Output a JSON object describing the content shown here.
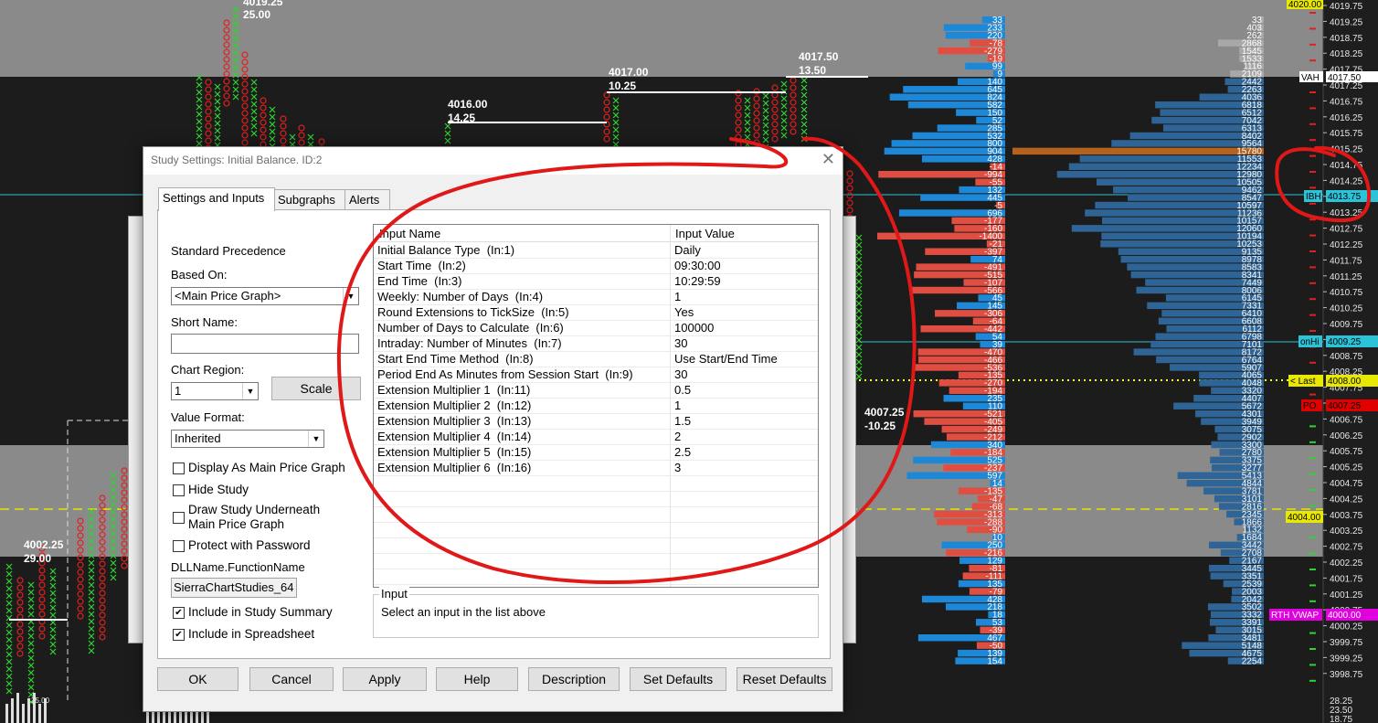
{
  "chart": {
    "price_ticks": [
      "4019.75",
      "4019.25",
      "4018.75",
      "4018.25",
      "4017.75",
      "4017.25",
      "4016.75",
      "4016.25",
      "4015.75",
      "4015.25",
      "4014.75",
      "4014.25",
      "4013.75",
      "4013.25",
      "4012.75",
      "4012.25",
      "4011.75",
      "4011.25",
      "4010.75",
      "4010.25",
      "4009.75",
      "4009.25",
      "4008.75",
      "4008.25",
      "4007.75",
      "4007.25",
      "4006.75",
      "4006.25",
      "4005.75",
      "4005.25",
      "4004.75",
      "4004.25",
      "4003.75",
      "4003.25",
      "4002.75",
      "4002.25",
      "4001.75",
      "4001.25",
      "4000.75",
      "4000.25",
      "3999.75",
      "3999.25",
      "3998.75"
    ],
    "bottom_ticks": [
      "28.25",
      "23.50",
      "18.75"
    ],
    "left_bottom_tick": "25.00",
    "annotations": [
      {
        "price": "4019.25",
        "value": "25.00"
      },
      {
        "price": "4016.00",
        "value": "14.25"
      },
      {
        "price": "4017.00",
        "value": "10.25"
      },
      {
        "price": "4017.50",
        "value": "13.50"
      },
      {
        "price": "4007.25",
        "value": "-10.25"
      },
      {
        "price": "4002.25",
        "value": "29.00"
      }
    ],
    "delta_values": [
      "33",
      "233",
      "220",
      "-78",
      "-279",
      "-19",
      "99",
      "9",
      "140",
      "645",
      "824",
      "582",
      "150",
      "52",
      "285",
      "532",
      "800",
      "904",
      "428",
      "-14",
      "-994",
      "-55",
      "132",
      "445",
      "-5",
      "696",
      "-177",
      "-160",
      "-1400",
      "-21",
      "-397",
      "74",
      "-491",
      "-515",
      "-107",
      "-566",
      "45",
      "145",
      "-306",
      "-64",
      "-442",
      "54",
      "39",
      "-470",
      "-466",
      "-536",
      "-135",
      "-270",
      "-194",
      "235",
      "110",
      "-521",
      "-405",
      "-249",
      "-212",
      "340",
      "-184",
      "525",
      "-237",
      "597",
      "14",
      "-135",
      "-47",
      "-68",
      "-313",
      "-288",
      "-90",
      "10",
      "250",
      "-216",
      "129",
      "-81",
      "-111",
      "135",
      "-79",
      "428",
      "218",
      "18",
      "53",
      "-39",
      "467",
      "-50",
      "139",
      "154"
    ],
    "volume_values": [
      "33",
      "403",
      "262",
      "2868",
      "1545",
      "1533",
      "1116",
      "2109",
      "2442",
      "2263",
      "4036",
      "6818",
      "6512",
      "7042",
      "6313",
      "8402",
      "9564",
      "15780",
      "11553",
      "12234",
      "12980",
      "10505",
      "9462",
      "8547",
      "10597",
      "11236",
      "10157",
      "12060",
      "10194",
      "10253",
      "9135",
      "8978",
      "8583",
      "8341",
      "7449",
      "8006",
      "6145",
      "7331",
      "6410",
      "6608",
      "6112",
      "6798",
      "7101",
      "8172",
      "6764",
      "5907",
      "4065",
      "4048",
      "3320",
      "4407",
      "5672",
      "4301",
      "3949",
      "3075",
      "2902",
      "3300",
      "2780",
      "3375",
      "3277",
      "5413",
      "4844",
      "3781",
      "3101",
      "2816",
      "2345",
      "1866",
      "1132",
      "1684",
      "3442",
      "2708",
      "2167",
      "3445",
      "3351",
      "2539",
      "2003",
      "2042",
      "3502",
      "3332",
      "3391",
      "3015",
      "3481",
      "5148",
      "4675",
      "2254"
    ],
    "tags": {
      "vah": "VAH",
      "ibh": "IBH",
      "ibh_price": "4013.75",
      "onh": "onHi",
      "onh_price": "4009.25",
      "last": "< Last",
      "last_price": "4008.00",
      "poc": "PO",
      "poc_price": "4007.25",
      "price_4004": "4004.00",
      "vwap": "RTH VWAP",
      "vwap_price": "4000.00",
      "top_price": "4020.00",
      "vah_price": "4017.50"
    },
    "colors": {
      "positive": "#1e88d8",
      "negative": "#e04e42",
      "volume": "#2e6596",
      "poc": "#b4621e",
      "annotation_circle": "#e01818"
    }
  },
  "dialog": {
    "title": "Study Settings: Initial Balance. ID:2",
    "close": "✕",
    "tabs": [
      "Settings and Inputs",
      "Subgraphs",
      "Alerts"
    ],
    "left": {
      "standard_precedence": "Standard Precedence",
      "based_on_label": "Based On:",
      "based_on_value": "<Main Price Graph>",
      "short_name_label": "Short Name:",
      "short_name_value": "",
      "chart_region_label": "Chart Region:",
      "chart_region_value": "1",
      "scale_button": "Scale",
      "value_format_label": "Value Format:",
      "value_format_value": "Inherited",
      "checkboxes": [
        {
          "label": "Display As Main Price Graph",
          "checked": false
        },
        {
          "label": "Hide Study",
          "checked": false
        },
        {
          "label": "Draw Study Underneath\nMain Price Graph",
          "checked": false
        },
        {
          "label": "Protect with Password",
          "checked": false
        }
      ],
      "dll_label": "DLLName.FunctionName",
      "dll_value": "SierraChartStudies_64",
      "include_summary": "Include in Study Summary",
      "include_spreadsheet": "Include in Spreadsheet",
      "include_summary_checked": true,
      "include_spreadsheet_checked": true
    },
    "grid": {
      "headers": [
        "Input Name",
        "Input Value"
      ],
      "rows": [
        [
          "Initial Balance Type  (In:1)",
          "Daily"
        ],
        [
          "Start Time  (In:2)",
          "09:30:00"
        ],
        [
          "End Time  (In:3)",
          "10:29:59"
        ],
        [
          "Weekly: Number of Days  (In:4)",
          "1"
        ],
        [
          "Round Extensions to TickSize  (In:5)",
          "Yes"
        ],
        [
          "Number of Days to Calculate  (In:6)",
          "100000"
        ],
        [
          "Intraday: Number of Minutes  (In:7)",
          "30"
        ],
        [
          "Start End Time Method  (In:8)",
          "Use Start/End Time"
        ],
        [
          "Period End As Minutes from Session Start  (In:9)",
          "30"
        ],
        [
          "Extension Multiplier 1  (In:11)",
          "0.5"
        ],
        [
          "Extension Multiplier 2  (In:12)",
          "1"
        ],
        [
          "Extension Multiplier 3  (In:13)",
          "1.5"
        ],
        [
          "Extension Multiplier 4  (In:14)",
          "2"
        ],
        [
          "Extension Multiplier 5  (In:15)",
          "2.5"
        ],
        [
          "Extension Multiplier 6  (In:16)",
          "3"
        ]
      ]
    },
    "input_box": {
      "legend": "Input",
      "message": "Select an input in the list above"
    },
    "buttons": [
      "OK",
      "Cancel",
      "Apply",
      "Help",
      "Description",
      "Set Defaults",
      "Reset Defaults"
    ]
  }
}
